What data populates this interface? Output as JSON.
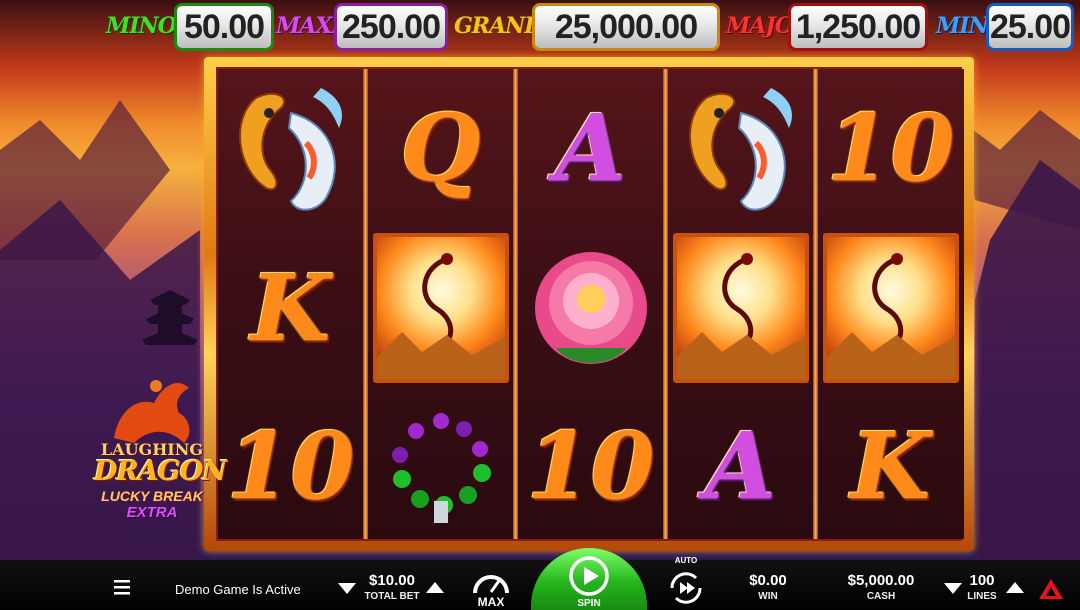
{
  "jackpots": [
    {
      "name": "MINOR",
      "value": "50.00",
      "label_color": "#42e020",
      "box_border": "#1a8a12"
    },
    {
      "name": "MAXI",
      "value": "250.00",
      "label_color": "#d64cf0",
      "box_border": "#8a1ea0"
    },
    {
      "name": "GRAND",
      "value": "25,000.00",
      "label_color": "#f7c21a",
      "box_border": "#c88a0e"
    },
    {
      "name": "MAJOR",
      "value": "1,250.00",
      "label_color": "#ff3030",
      "box_border": "#a01010"
    },
    {
      "name": "MINI",
      "value": "25.00",
      "label_color": "#3aa0ff",
      "box_border": "#1a5ac0"
    }
  ],
  "logo": {
    "line1": "LAUGHING",
    "line2": "DRAGON",
    "line3": "LUCKY BREAK",
    "line4": "EXTRA"
  },
  "reels": [
    [
      "koi-fish",
      "K",
      "10"
    ],
    [
      "Q",
      "moon-dragon",
      "bead-bracelet"
    ],
    [
      "A",
      "peony-flower",
      "10"
    ],
    [
      "koi-fish",
      "moon-dragon",
      "A"
    ],
    [
      "10",
      "moon-dragon",
      "K"
    ]
  ],
  "controls": {
    "menu_icon": "hamburger-icon",
    "status": "Demo Game Is Active",
    "total_bet_value": "$10.00",
    "total_bet_label": "TOTAL BET",
    "max_label": "MAX",
    "spin_label": "SPIN",
    "auto_label": "AUTO",
    "win_value": "$0.00",
    "win_label": "WIN",
    "cash_value": "$5,000.00",
    "cash_label": "CASH",
    "lines_value": "100",
    "lines_label": "LINES"
  },
  "colors": {
    "spin_green": "#25b51d",
    "frame_gold": "#ffb84a",
    "reel_bg": "#3a0e14"
  }
}
